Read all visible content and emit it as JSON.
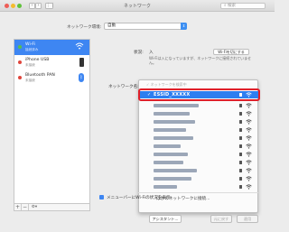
{
  "window": {
    "title": "ネットワーク",
    "search_placeholder": "検索"
  },
  "location": {
    "label": "ネットワーク環境:",
    "value": "自動"
  },
  "sidebar": {
    "items": [
      {
        "name": "Wi-Fi",
        "sub": "接続済み",
        "status": "green",
        "selected": true,
        "icon": "wifi-icon"
      },
      {
        "name": "iPhone USB",
        "sub": "未接続",
        "status": "red",
        "selected": false,
        "icon": "iphone-icon"
      },
      {
        "name": "Bluetooth PAN",
        "sub": "未接続",
        "status": "red",
        "selected": false,
        "icon": "bluetooth-icon"
      }
    ],
    "add_label": "+",
    "remove_label": "−",
    "gear_label": "⚙▾"
  },
  "detail": {
    "status_label": "状況:",
    "status_value": "入",
    "status_desc": "Wi-Fiは入になっていますが、ネットワークに接続されていません。",
    "wifi_off_button": "Wi-Fiを切にする",
    "network_name_label": "ネットワーク名:",
    "dropdown_header": "✓ ネットワークを検索中",
    "selected_network": "ESSID_XXXXX",
    "join_other": "ほかのネットワークに接続...",
    "menubar_label": "メニューバーにWi-Fiの状況を表示"
  },
  "footer": {
    "advanced": "詳細...",
    "revert": "元に戻す",
    "apply": "適用",
    "assist": "アシスタント..."
  },
  "colors": {
    "accent": "#2e7ef0",
    "highlight": "#e0202a"
  }
}
